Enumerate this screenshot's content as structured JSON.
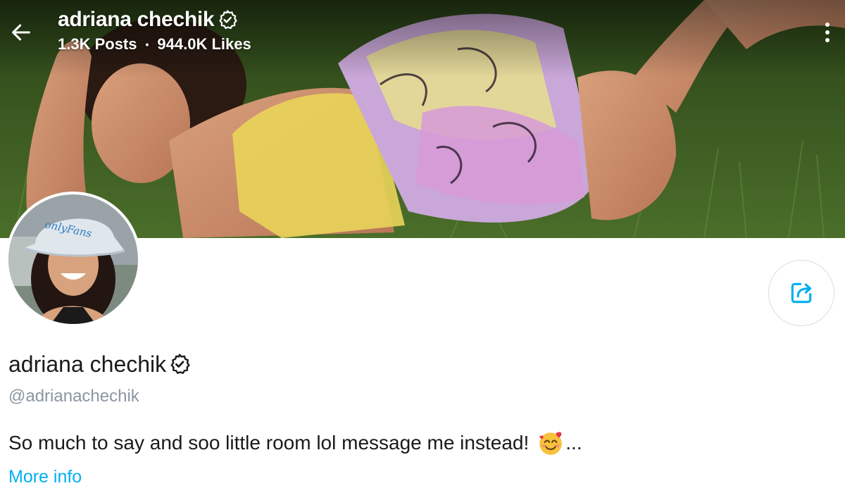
{
  "header": {
    "name": "adriana chechik",
    "posts": "1.3K Posts",
    "separator": "•",
    "likes": "944.0K Likes"
  },
  "profile": {
    "name": "adriana chechik",
    "handle": "@adrianachechik",
    "bio": "So much to say and soo little room lol message me instead!",
    "bio_suffix": "...",
    "more_info": "More info",
    "avatar_hat_text": "onlyFans"
  },
  "icons": {
    "back": "arrow-left-icon",
    "more": "vertical-dots-icon",
    "verified": "verified-badge-icon",
    "share": "share-icon",
    "emoji": "smiling-face-with-hearts-icon"
  },
  "colors": {
    "accent": "#00aff0",
    "handle": "#8a96a3",
    "text": "#1a1a1a"
  }
}
